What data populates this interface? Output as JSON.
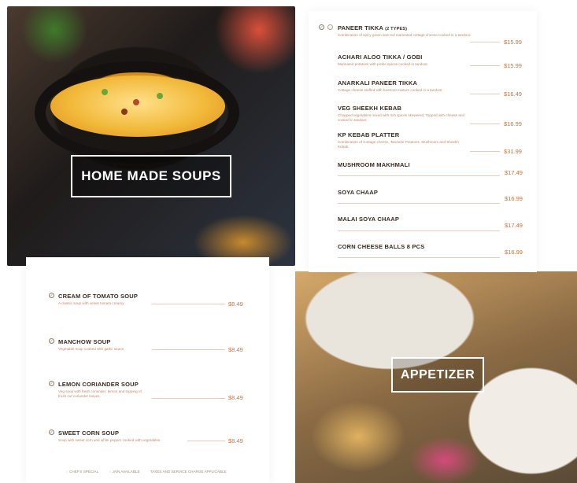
{
  "soup_section": {
    "title": "HOME MADE SOUPS",
    "items": [
      {
        "name": "CREAM OF TOMATO SOUP",
        "description": "A classic soup with velvet tomato creamy.",
        "price": "$8.49"
      },
      {
        "name": "MANCHOW SOUP",
        "description": "Vegetable soup cooked with garlic sauce.",
        "price": "$8.49"
      },
      {
        "name": "LEMON CORIANDER SOUP",
        "description": "Veg soup with fresh coriander, lemon and topping of fresh cut coriander leaves.",
        "price": "$8.49"
      },
      {
        "name": "SWEET CORN SOUP",
        "description": "Soup with sweet corn and white pepper cooked with vegetables.",
        "price": "$8.49"
      }
    ]
  },
  "appetizer_section": {
    "title": "APPETIZER",
    "items": [
      {
        "name": "PANEER TIKKA",
        "name_suffix": "(2 TYPES)",
        "description": "Combination of spicy green and red marinated cottage cheese cooked in a tandoor.",
        "price": "$15.99"
      },
      {
        "name": "ACHARI ALOO TIKKA / GOBI",
        "description": "Marinated potatoes with pickle spices cooked in tandoor.",
        "price": "$15.99"
      },
      {
        "name": "ANARKALI PANEER TIKKA",
        "description": "Cottage cheese stuffed with beetroot mixture cooked in a tandoor.",
        "price": "$16.49"
      },
      {
        "name": "VEG SHEEKH KEBAB",
        "description": "Chopped vegetables mixed with rich spices skewered, Topped with cheese and cooked in tandoor.",
        "price": "$16.99"
      },
      {
        "name": "KP KEBAB PLATTER",
        "description": "Combination of Cottage cheese, Tandoori Potatoes, Mushroom and Sheekh Kebab.",
        "price": "$31.99"
      },
      {
        "name": "MUSHROOM MAKHMALI",
        "description": "",
        "price": "$17.49"
      },
      {
        "name": "SOYA CHAAP",
        "description": "",
        "price": "$16.99"
      },
      {
        "name": "MALAI SOYA CHAAP",
        "description": "",
        "price": "$17.49"
      },
      {
        "name": "CORN CHEESE BALLS 8 PCS",
        "description": "",
        "price": "$16.99"
      }
    ]
  },
  "legend": {
    "chef_special": "CHEF'S SPECIAL",
    "jain_available": "JAIN AVAILABLE",
    "taxes_note": "TAXES AND SERVICE CHARGE APPLICABLE"
  },
  "colors": {
    "price": "#c8733a",
    "name": "#3a2a22",
    "description": "#c08a6a"
  },
  "icons": {
    "soup_item_icon": "chef-special-icon",
    "appetizer_first_icon": "chef-special-icon"
  }
}
